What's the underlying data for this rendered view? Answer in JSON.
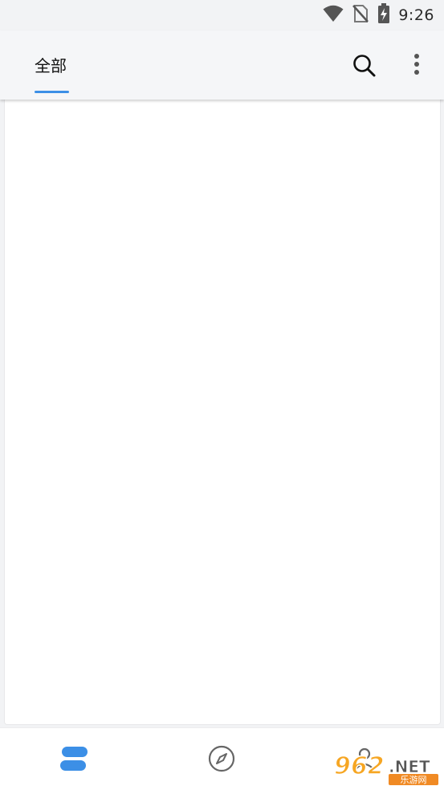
{
  "status_bar": {
    "time": "9:26",
    "icons": [
      "wifi-icon",
      "no-sim-icon",
      "battery-charging-icon"
    ]
  },
  "app_bar": {
    "tabs": [
      {
        "label": "全部",
        "active": true
      }
    ],
    "actions": [
      "search-icon",
      "more-vert-icon"
    ],
    "accent_color": "#3c8fe6"
  },
  "bottom_nav": {
    "items": [
      {
        "icon": "bookshelf-icon",
        "active": true
      },
      {
        "icon": "compass-icon",
        "active": false
      },
      {
        "icon": "person-icon",
        "active": false
      }
    ]
  },
  "watermark": {
    "text": "962.NET",
    "subtext": "乐游网"
  }
}
